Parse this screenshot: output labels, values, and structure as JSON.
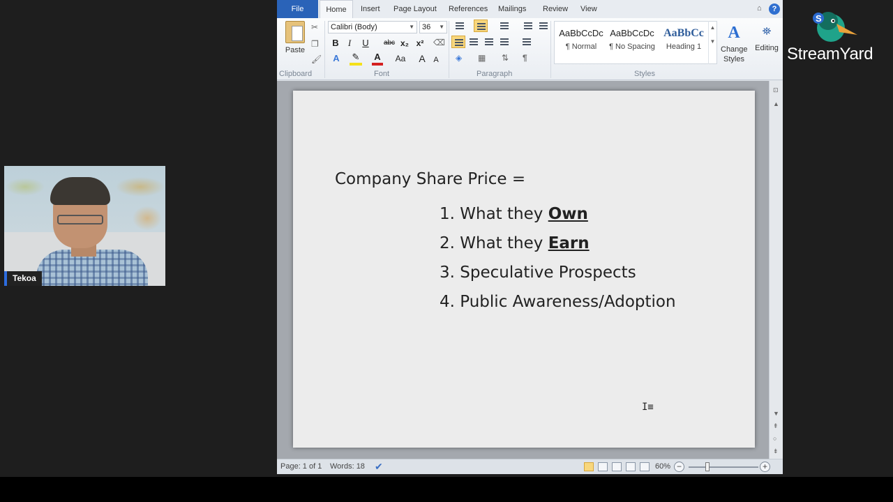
{
  "overlay": {
    "participant_name": "Tekoa",
    "brand_name": "StreamYard"
  },
  "ribbon": {
    "tabs": [
      "File",
      "Home",
      "Insert",
      "Page Layout",
      "References",
      "Mailings",
      "Review",
      "View"
    ],
    "help_label": "?",
    "clipboard": {
      "paste_label": "Paste",
      "group_label": "Clipboard"
    },
    "font": {
      "font_name": "Calibri (Body)",
      "font_size": "36",
      "group_label": "Font",
      "bold": "B",
      "italic": "I",
      "underline": "U",
      "strike": "abc",
      "subscript": "x₂",
      "superscript": "x²",
      "grow": "A",
      "shrink": "A",
      "case": "Aa"
    },
    "paragraph": {
      "group_label": "Paragraph",
      "pilcrow": "¶"
    },
    "styles": {
      "group_label": "Styles",
      "items": [
        {
          "preview": "AaBbCcDc",
          "name": "¶ Normal"
        },
        {
          "preview": "AaBbCcDc",
          "name": "¶ No Spacing"
        },
        {
          "preview": "AaBbCc",
          "name": "Heading 1"
        }
      ],
      "change_styles_label": "Change Styles",
      "editing_label": "Editing"
    }
  },
  "document": {
    "heading": "Company Share Price =",
    "items": [
      {
        "num": "1.",
        "prefix": "What they ",
        "bold": "Own",
        "suffix": ""
      },
      {
        "num": "2.",
        "prefix": "What they ",
        "bold": "Earn",
        "suffix": ""
      },
      {
        "num": "3.",
        "prefix": "Speculative Prospects",
        "bold": "",
        "suffix": ""
      },
      {
        "num": "4.",
        "prefix": "Public Awareness/Adoption",
        "bold": "",
        "suffix": ""
      }
    ]
  },
  "statusbar": {
    "page": "Page: 1 of 1",
    "words": "Words: 18",
    "zoom": "60%"
  },
  "colors": {
    "accent": "#2a63b8",
    "streamyard_duck": "#1fa38a"
  }
}
